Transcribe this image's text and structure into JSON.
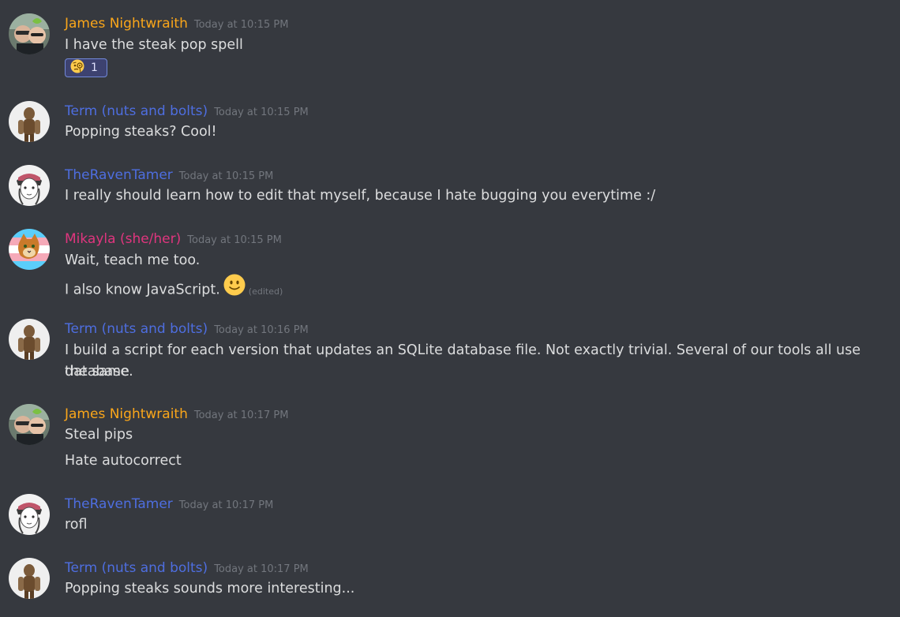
{
  "colors": {
    "background": "#36393f",
    "text": "#dcddde",
    "timestamp": "#72767d",
    "author_orange": "#faa61a",
    "author_blue": "#4e6ee0",
    "author_pink": "#e0357e"
  },
  "messages": [
    {
      "author": "James Nightwraith",
      "timestamp": "Today at 10:15 PM",
      "avatar_icon": "james-avatar-icon",
      "lines": [
        "I have the steak pop spell"
      ],
      "reaction": {
        "emoji": "face-with-monocle-icon",
        "count": "1"
      }
    },
    {
      "author": "Term (nuts and bolts)",
      "timestamp": "Today at 10:15 PM",
      "avatar_icon": "term-avatar-icon",
      "lines": [
        "Popping steaks?  Cool!"
      ]
    },
    {
      "author": "TheRavenTamer",
      "timestamp": "Today at 10:15 PM",
      "avatar_icon": "raven-avatar-icon",
      "lines": [
        "I really should learn how to edit that myself, because I hate bugging you everytime :/"
      ]
    },
    {
      "author": "Mikayla (she/her)",
      "timestamp": "Today at 10:15 PM",
      "avatar_icon": "mikayla-avatar-icon",
      "lines": [
        "Wait, teach me too.",
        "I also know JavaScript."
      ],
      "edited_label": "(edited)",
      "emoji": "slightly-smiling-face-icon"
    },
    {
      "author": "Term (nuts and bolts)",
      "timestamp": "Today at 10:16 PM",
      "avatar_icon": "term-avatar-icon",
      "lines": [
        "I build a script for each version that updates an SQLite database file.  Not exactly trivial.  Several of our tools all use the same",
        "database."
      ]
    },
    {
      "author": "James Nightwraith",
      "timestamp": "Today at 10:17 PM",
      "avatar_icon": "james-avatar-icon",
      "lines": [
        "Steal pips",
        "Hate autocorrect"
      ]
    },
    {
      "author": "TheRavenTamer",
      "timestamp": "Today at 10:17 PM",
      "avatar_icon": "raven-avatar-icon",
      "lines": [
        "rofl"
      ]
    },
    {
      "author": "Term (nuts and bolts)",
      "timestamp": "Today at 10:17 PM",
      "avatar_icon": "term-avatar-icon",
      "lines": [
        "Popping steaks sounds more interesting..."
      ]
    }
  ]
}
